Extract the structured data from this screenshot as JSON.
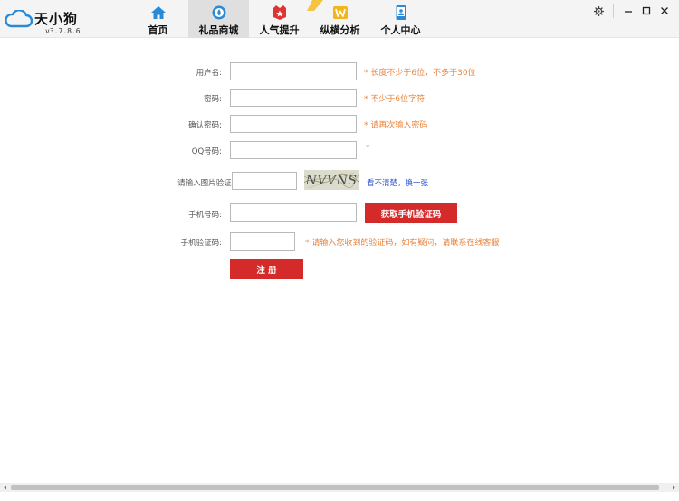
{
  "app": {
    "name": "天小狗",
    "version": "v3.7.8.6"
  },
  "nav": {
    "items": [
      {
        "label": "首页",
        "icon": "home-icon"
      },
      {
        "label": "礼品商城",
        "icon": "gift-shop-icon",
        "active": true
      },
      {
        "label": "人气提升",
        "icon": "popularity-icon"
      },
      {
        "label": "纵横分析",
        "icon": "analysis-icon"
      },
      {
        "label": "个人中心",
        "icon": "user-center-icon"
      }
    ]
  },
  "colors": {
    "accent_red": "#d42a2a",
    "hint_orange": "#e8833a",
    "link_blue": "#2c4fd0",
    "nav_blue": "#2b8ad6"
  },
  "form": {
    "username": {
      "label": "用户名:",
      "value": "",
      "hint": "* 长度不少于6位，不多于30位"
    },
    "password": {
      "label": "密码:",
      "value": "",
      "hint": "* 不少于6位字符"
    },
    "confirm_password": {
      "label": "确认密码:",
      "value": "",
      "hint": "* 请再次输入密码"
    },
    "qq": {
      "label": "QQ号码:",
      "value": "",
      "hint": "*"
    },
    "captcha": {
      "label": "请输入图片验证码:",
      "value": "",
      "image_text": "NVVNS",
      "refresh_link": "看不清楚，换一张"
    },
    "phone": {
      "label": "手机号码:",
      "value": "",
      "button": "获取手机验证码"
    },
    "sms_code": {
      "label": "手机验证码:",
      "value": "",
      "hint": "* 请输入您收到的验证码，如有疑问，请联系在线客服"
    },
    "submit": "注 册"
  }
}
